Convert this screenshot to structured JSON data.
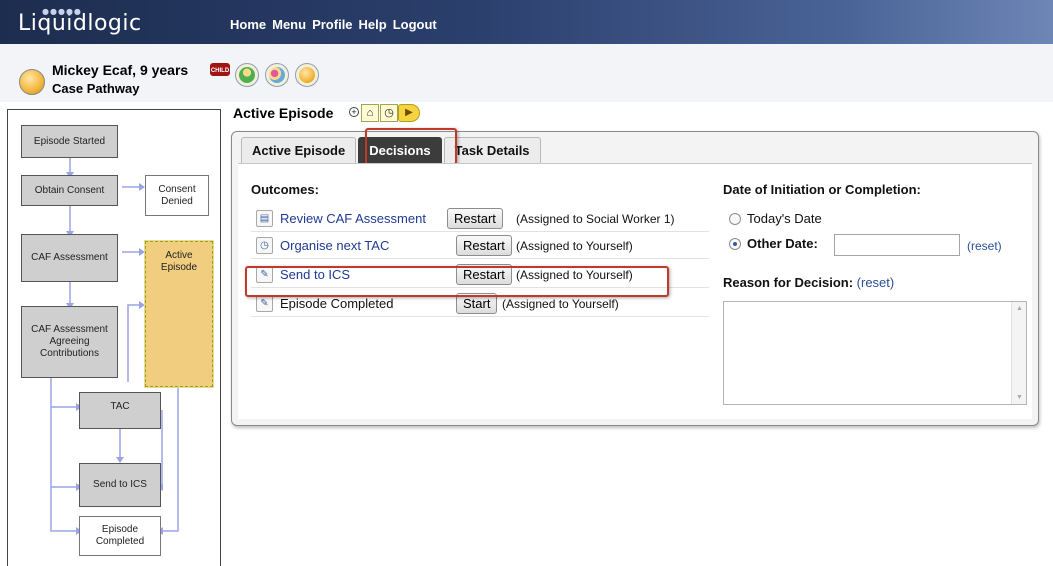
{
  "app": {
    "logo": "Liquidlogic"
  },
  "nav": [
    {
      "label": "Home"
    },
    {
      "label": "Menu"
    },
    {
      "label": "Profile"
    },
    {
      "label": "Help"
    },
    {
      "label": "Logout"
    }
  ],
  "person": {
    "name": "Mickey Ecaf, 9 years",
    "badge": "CHILD",
    "subtitle": "Case Pathway"
  },
  "pathway": {
    "nodes": [
      {
        "id": "episode_started",
        "label": "Episode Started"
      },
      {
        "id": "obtain_consent",
        "label": "Obtain Consent"
      },
      {
        "id": "consent_denied",
        "label": "Consent Denied"
      },
      {
        "id": "caf_assessment",
        "label": "CAF Assessment"
      },
      {
        "id": "active_episode",
        "label": "Active Episode"
      },
      {
        "id": "caf_agreeing",
        "label": "CAF Assessment Agreeing Contributions"
      },
      {
        "id": "tac",
        "label": "TAC"
      },
      {
        "id": "send_to_ics",
        "label": "Send to ICS"
      },
      {
        "id": "episode_completed",
        "label": "Episode Completed"
      }
    ]
  },
  "episode": {
    "title": "Active Episode",
    "tabs": [
      {
        "label": "Active Episode",
        "selected": false
      },
      {
        "label": "Decisions",
        "selected": true
      },
      {
        "label": "Task Details",
        "selected": false
      }
    ]
  },
  "outcomes": {
    "title": "Outcomes:",
    "rows": [
      {
        "icon": "document-icon",
        "label": "Review CAF Assessment",
        "button": "Restart",
        "assigned": "(Assigned to Social Worker 1)"
      },
      {
        "icon": "clock-icon",
        "label": "Organise next TAC",
        "button": "Restart",
        "assigned": "(Assigned to Yourself)"
      },
      {
        "icon": "pencil-icon",
        "label": "Send to ICS",
        "button": "Restart",
        "assigned": "(Assigned to Yourself)"
      },
      {
        "icon": "pencil-icon",
        "label": "Episode Completed",
        "button": "Start",
        "assigned": "(Assigned to Yourself)"
      }
    ]
  },
  "decision_date": {
    "title": "Date of Initiation or Completion:",
    "options": [
      {
        "label": "Today's Date",
        "selected": false
      },
      {
        "label": "Other Date:",
        "selected": true
      }
    ],
    "other_date_value": "",
    "reset": "(reset)"
  },
  "reason": {
    "title": "Reason for Decision:",
    "reset": "(reset)",
    "value": ""
  },
  "colors": {
    "header_dark": "#1d2d4f",
    "active_node": "#f0cd7f",
    "highlight": "#c0392b",
    "selected_tab": "#3c3c3c",
    "link": "#1f3a93"
  }
}
